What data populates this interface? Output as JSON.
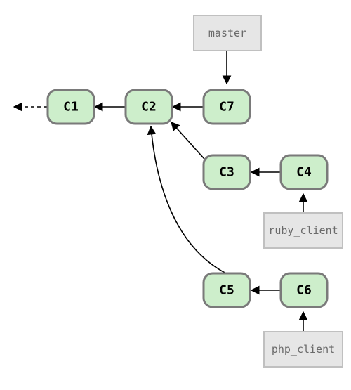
{
  "commits": {
    "c1": "C1",
    "c2": "C2",
    "c3": "C3",
    "c4": "C4",
    "c5": "C5",
    "c6": "C6",
    "c7": "C7"
  },
  "branches": {
    "master": "master",
    "ruby_client": "ruby_client",
    "php_client": "php_client"
  },
  "chart_data": {
    "type": "diagram",
    "title": "Git commit graph with branch pointers",
    "nodes": [
      {
        "id": "C1",
        "kind": "commit"
      },
      {
        "id": "C2",
        "kind": "commit"
      },
      {
        "id": "C3",
        "kind": "commit"
      },
      {
        "id": "C4",
        "kind": "commit"
      },
      {
        "id": "C5",
        "kind": "commit"
      },
      {
        "id": "C6",
        "kind": "commit"
      },
      {
        "id": "C7",
        "kind": "commit"
      },
      {
        "id": "master",
        "kind": "branch"
      },
      {
        "id": "ruby_client",
        "kind": "branch"
      },
      {
        "id": "php_client",
        "kind": "branch"
      }
    ],
    "edges": [
      {
        "from": "C1",
        "to": "history",
        "dashed": true
      },
      {
        "from": "C2",
        "to": "C1"
      },
      {
        "from": "C7",
        "to": "C2"
      },
      {
        "from": "C3",
        "to": "C2"
      },
      {
        "from": "C4",
        "to": "C3"
      },
      {
        "from": "C5",
        "to": "C2"
      },
      {
        "from": "C6",
        "to": "C5"
      },
      {
        "from": "master",
        "to": "C7"
      },
      {
        "from": "ruby_client",
        "to": "C4"
      },
      {
        "from": "php_client",
        "to": "C6"
      }
    ]
  }
}
